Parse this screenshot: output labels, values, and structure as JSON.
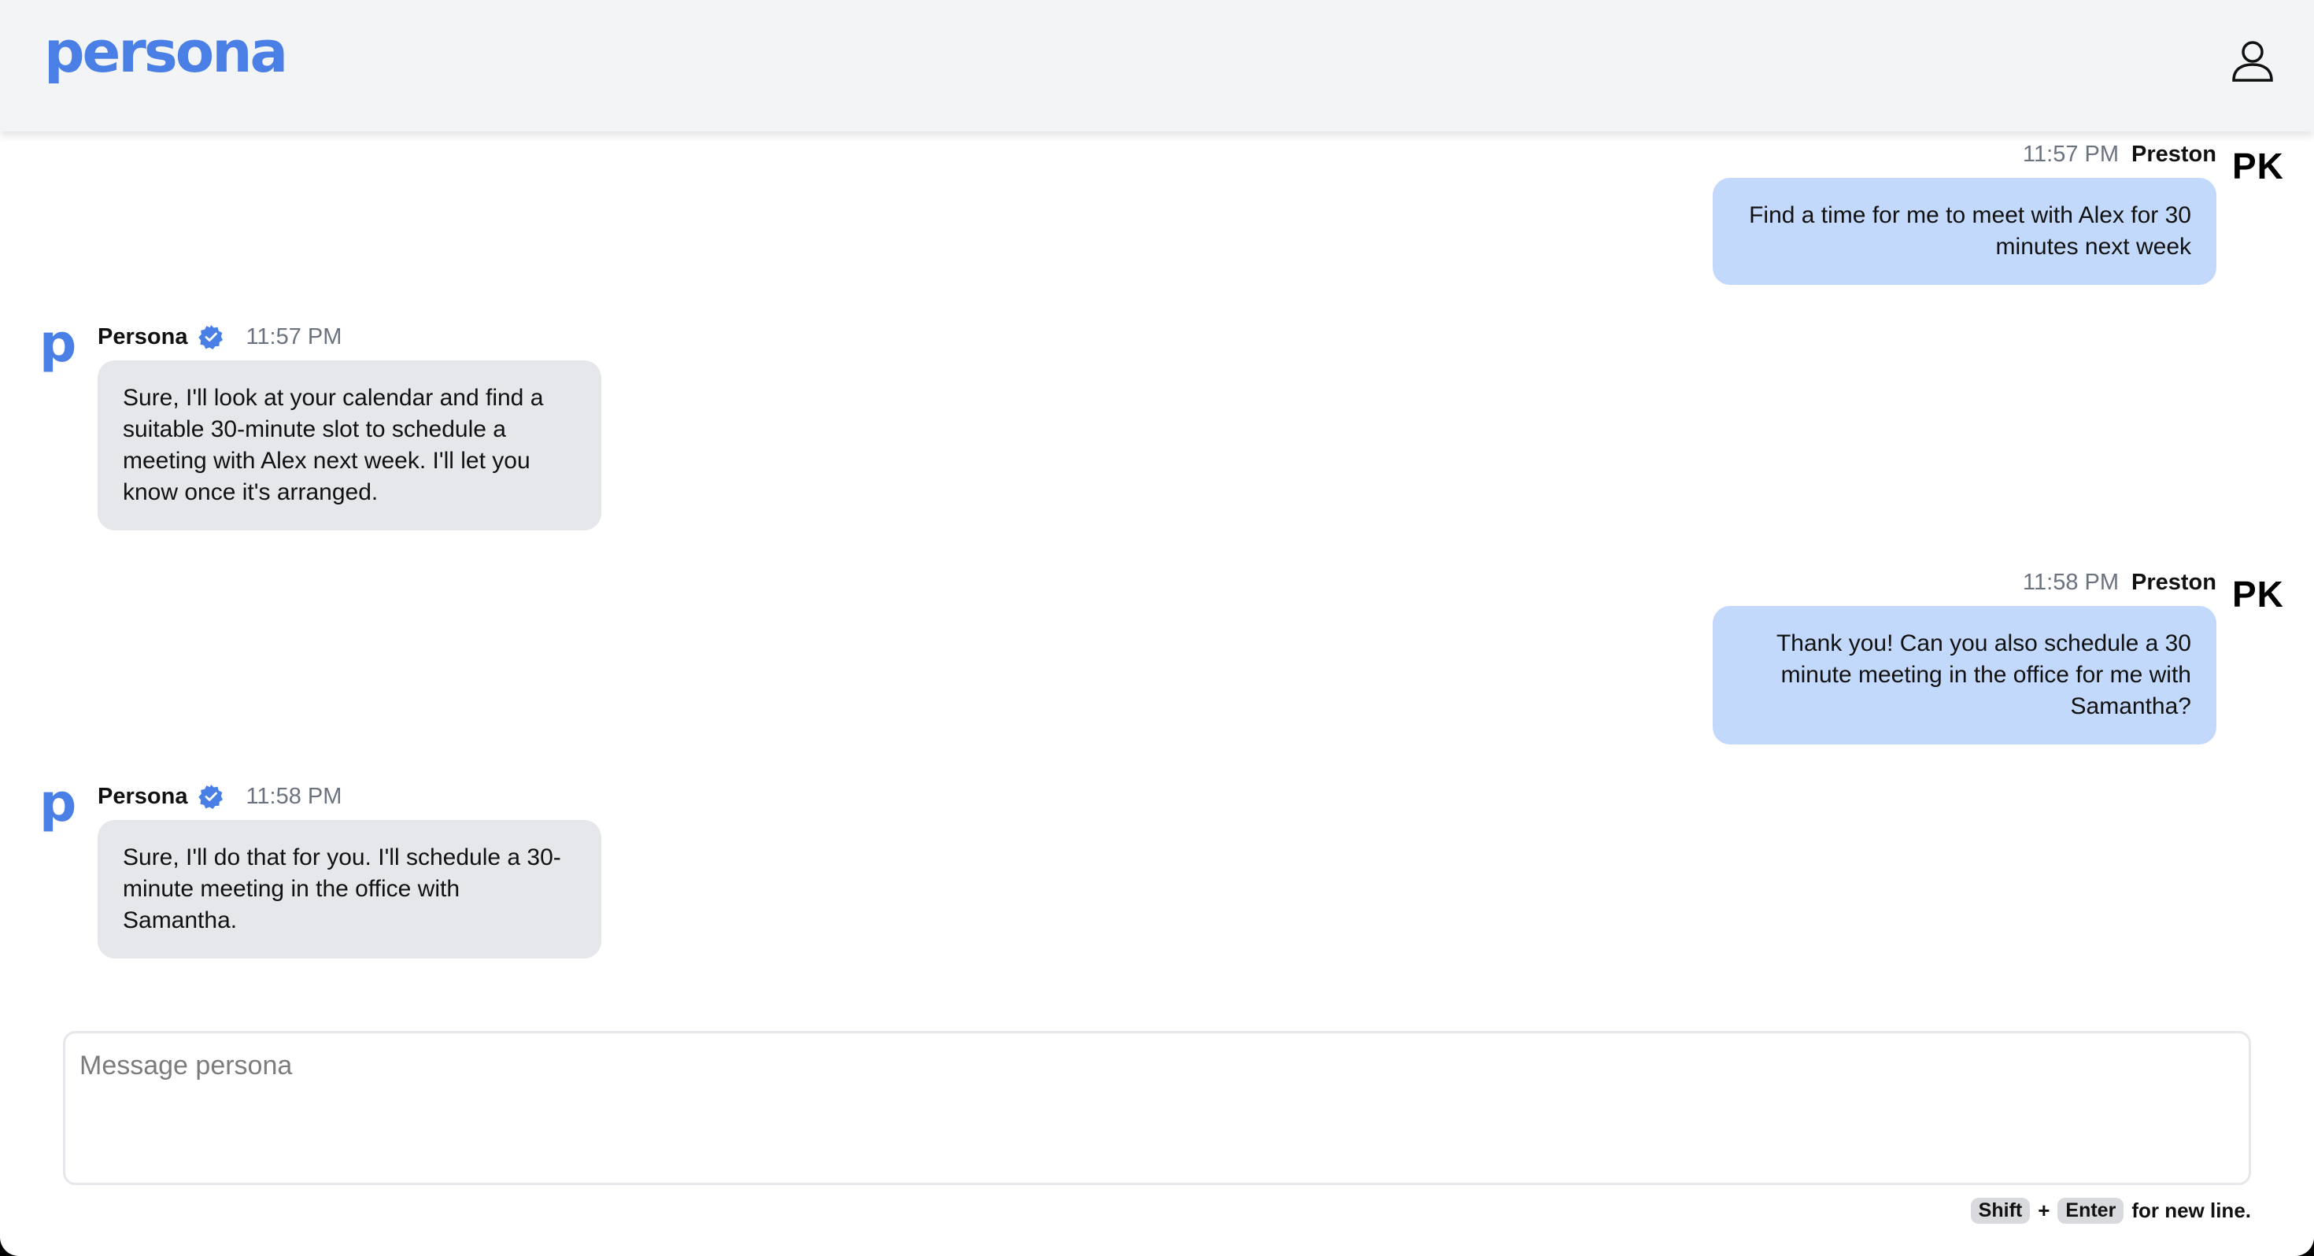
{
  "header": {
    "logo": "persona",
    "profile_icon": "user-icon"
  },
  "messages": [
    {
      "sender": "Preston",
      "initials": "PK",
      "time": "11:57 PM",
      "text": "Find a time for me to meet with Alex for 30 minutes next week"
    },
    {
      "sender": "Persona",
      "avatar_letter": "p",
      "verified_icon": "verified-badge-icon",
      "time": "11:57 PM",
      "text": "Sure, I'll look at your calendar and find a suitable 30-minute slot to schedule a meeting with Alex next week. I'll let you know once it's arranged."
    },
    {
      "sender": "Preston",
      "initials": "PK",
      "time": "11:58 PM",
      "text": "Thank you! Can you also schedule a 30 minute meeting in the office for me with Samantha?"
    },
    {
      "sender": "Persona",
      "avatar_letter": "p",
      "verified_icon": "verified-badge-icon",
      "time": "11:58 PM",
      "text": "Sure, I'll do that for you. I'll schedule a 30-minute meeting in the office with Samantha."
    }
  ],
  "composer": {
    "placeholder": "Message persona",
    "value": ""
  },
  "hint": {
    "key1": "Shift",
    "plus": "+",
    "key2": "Enter",
    "suffix": "for new line."
  },
  "colors": {
    "brand": "#4a7fe6",
    "user_bubble": "#c3d9fb",
    "bot_bubble": "#e5e7eb",
    "header_bg": "#f3f4f6"
  }
}
